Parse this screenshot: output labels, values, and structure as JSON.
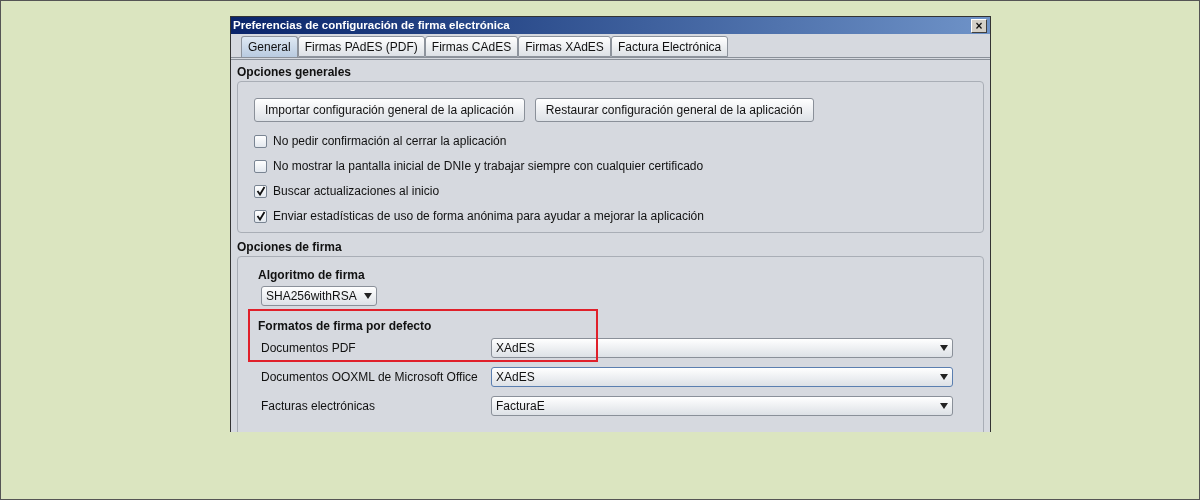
{
  "window": {
    "title": "Preferencias de configuración de firma electrónica",
    "close": "×"
  },
  "tabs": [
    {
      "label": "General",
      "selected": true
    },
    {
      "label": "Firmas PAdES (PDF)",
      "selected": false
    },
    {
      "label": "Firmas CAdES",
      "selected": false
    },
    {
      "label": "Firmas XAdES",
      "selected": false
    },
    {
      "label": "Factura Electrónica",
      "selected": false
    }
  ],
  "general_options": {
    "title": "Opciones generales",
    "buttons": [
      "Importar configuración general de la aplicación",
      "Restaurar configuración general de la aplicación"
    ],
    "checkboxes": [
      {
        "label": "No pedir confirmación al cerrar la aplicación",
        "checked": false
      },
      {
        "label": "No mostrar la pantalla inicial de DNIe y trabajar siempre con cualquier certificado",
        "checked": false
      },
      {
        "label": "Buscar actualizaciones al inicio",
        "checked": true
      },
      {
        "label": "Enviar estadísticas de uso de forma anónima para ayudar a mejorar la aplicación",
        "checked": true
      }
    ]
  },
  "signature_options": {
    "title": "Opciones de firma",
    "algorithm": {
      "label": "Algoritmo de firma",
      "value": "SHA256withRSA"
    },
    "formats": {
      "heading": "Formatos de firma por defecto",
      "highlighted": true,
      "rows": [
        {
          "label": "Documentos PDF",
          "value": "XAdES"
        },
        {
          "label": "Documentos OOXML de Microsoft Office",
          "value": "XAdES"
        },
        {
          "label": "Facturas electrónicas",
          "value": "FacturaE"
        }
      ]
    }
  }
}
